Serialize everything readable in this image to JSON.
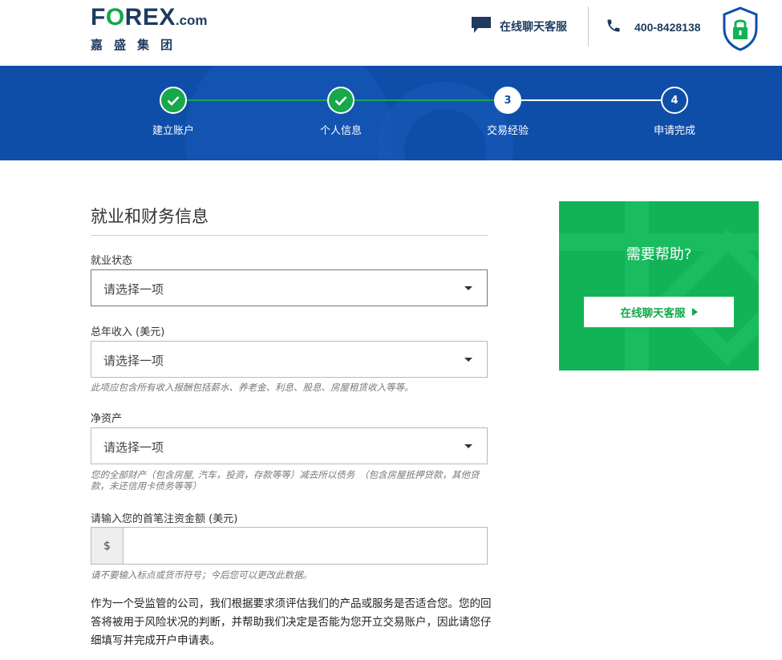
{
  "header": {
    "logo_pre": "F",
    "logo_o": "O",
    "logo_post": "REX",
    "logo_com": ".com",
    "logo_sub": "嘉盛集团",
    "chat_label": "在线聊天客服",
    "phone": "400-8428138"
  },
  "progress": {
    "steps": [
      {
        "label": "建立账户",
        "status": "done"
      },
      {
        "label": "个人信息",
        "status": "done"
      },
      {
        "label": "交易经验",
        "status": "current",
        "number": "3"
      },
      {
        "label": "申请完成",
        "status": "todo",
        "number": "4"
      }
    ]
  },
  "form": {
    "title": "就业和财务信息",
    "employment_label": "就业状态",
    "employment_value": "请选择一项",
    "income_label": "总年收入 (美元)",
    "income_value": "请选择一项",
    "income_hint": "此项应包含所有收入报酬包括薪水、养老金、利息、股息、房屋租赁收入等等。",
    "networth_label": "净资产",
    "networth_value": "请选择一项",
    "networth_hint": "您的全部财产（包含房屋, 汽车，投资，存款等等）减去所以债务　（包含房屋抵押贷款，其他贷款，未还信用卡债务等等）",
    "deposit_label": "请输入您的首笔注资金额 (美元)",
    "deposit_prefix": "$",
    "deposit_value": "",
    "deposit_hint": "请不要输入标点或货币符号；今后您可以更改此数据。",
    "disclaimer": "作为一个受监管的公司，我们根据要求须评估我们的产品或服务是否适合您。您的回答将被用于风险状况的判断，并帮助我们决定是否能为您开立交易账户，因此请您仔细填写并完成开户申请表。"
  },
  "help": {
    "title": "需要帮助?",
    "button_label": "在线聊天客服"
  },
  "colors": {
    "brand_blue": "#0e4ea9",
    "brand_green": "#11b356",
    "navy": "#1e3a5f"
  }
}
